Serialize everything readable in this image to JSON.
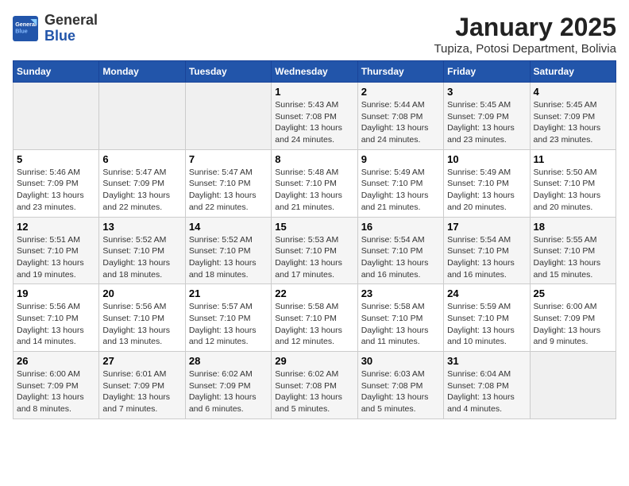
{
  "header": {
    "logo_general": "General",
    "logo_blue": "Blue",
    "month_title": "January 2025",
    "location": "Tupiza, Potosi Department, Bolivia"
  },
  "weekdays": [
    "Sunday",
    "Monday",
    "Tuesday",
    "Wednesday",
    "Thursday",
    "Friday",
    "Saturday"
  ],
  "weeks": [
    [
      {
        "day": "",
        "info": ""
      },
      {
        "day": "",
        "info": ""
      },
      {
        "day": "",
        "info": ""
      },
      {
        "day": "1",
        "info": "Sunrise: 5:43 AM\nSunset: 7:08 PM\nDaylight: 13 hours\nand 24 minutes."
      },
      {
        "day": "2",
        "info": "Sunrise: 5:44 AM\nSunset: 7:08 PM\nDaylight: 13 hours\nand 24 minutes."
      },
      {
        "day": "3",
        "info": "Sunrise: 5:45 AM\nSunset: 7:09 PM\nDaylight: 13 hours\nand 23 minutes."
      },
      {
        "day": "4",
        "info": "Sunrise: 5:45 AM\nSunset: 7:09 PM\nDaylight: 13 hours\nand 23 minutes."
      }
    ],
    [
      {
        "day": "5",
        "info": "Sunrise: 5:46 AM\nSunset: 7:09 PM\nDaylight: 13 hours\nand 23 minutes."
      },
      {
        "day": "6",
        "info": "Sunrise: 5:47 AM\nSunset: 7:09 PM\nDaylight: 13 hours\nand 22 minutes."
      },
      {
        "day": "7",
        "info": "Sunrise: 5:47 AM\nSunset: 7:10 PM\nDaylight: 13 hours\nand 22 minutes."
      },
      {
        "day": "8",
        "info": "Sunrise: 5:48 AM\nSunset: 7:10 PM\nDaylight: 13 hours\nand 21 minutes."
      },
      {
        "day": "9",
        "info": "Sunrise: 5:49 AM\nSunset: 7:10 PM\nDaylight: 13 hours\nand 21 minutes."
      },
      {
        "day": "10",
        "info": "Sunrise: 5:49 AM\nSunset: 7:10 PM\nDaylight: 13 hours\nand 20 minutes."
      },
      {
        "day": "11",
        "info": "Sunrise: 5:50 AM\nSunset: 7:10 PM\nDaylight: 13 hours\nand 20 minutes."
      }
    ],
    [
      {
        "day": "12",
        "info": "Sunrise: 5:51 AM\nSunset: 7:10 PM\nDaylight: 13 hours\nand 19 minutes."
      },
      {
        "day": "13",
        "info": "Sunrise: 5:52 AM\nSunset: 7:10 PM\nDaylight: 13 hours\nand 18 minutes."
      },
      {
        "day": "14",
        "info": "Sunrise: 5:52 AM\nSunset: 7:10 PM\nDaylight: 13 hours\nand 18 minutes."
      },
      {
        "day": "15",
        "info": "Sunrise: 5:53 AM\nSunset: 7:10 PM\nDaylight: 13 hours\nand 17 minutes."
      },
      {
        "day": "16",
        "info": "Sunrise: 5:54 AM\nSunset: 7:10 PM\nDaylight: 13 hours\nand 16 minutes."
      },
      {
        "day": "17",
        "info": "Sunrise: 5:54 AM\nSunset: 7:10 PM\nDaylight: 13 hours\nand 16 minutes."
      },
      {
        "day": "18",
        "info": "Sunrise: 5:55 AM\nSunset: 7:10 PM\nDaylight: 13 hours\nand 15 minutes."
      }
    ],
    [
      {
        "day": "19",
        "info": "Sunrise: 5:56 AM\nSunset: 7:10 PM\nDaylight: 13 hours\nand 14 minutes."
      },
      {
        "day": "20",
        "info": "Sunrise: 5:56 AM\nSunset: 7:10 PM\nDaylight: 13 hours\nand 13 minutes."
      },
      {
        "day": "21",
        "info": "Sunrise: 5:57 AM\nSunset: 7:10 PM\nDaylight: 13 hours\nand 12 minutes."
      },
      {
        "day": "22",
        "info": "Sunrise: 5:58 AM\nSunset: 7:10 PM\nDaylight: 13 hours\nand 12 minutes."
      },
      {
        "day": "23",
        "info": "Sunrise: 5:58 AM\nSunset: 7:10 PM\nDaylight: 13 hours\nand 11 minutes."
      },
      {
        "day": "24",
        "info": "Sunrise: 5:59 AM\nSunset: 7:10 PM\nDaylight: 13 hours\nand 10 minutes."
      },
      {
        "day": "25",
        "info": "Sunrise: 6:00 AM\nSunset: 7:09 PM\nDaylight: 13 hours\nand 9 minutes."
      }
    ],
    [
      {
        "day": "26",
        "info": "Sunrise: 6:00 AM\nSunset: 7:09 PM\nDaylight: 13 hours\nand 8 minutes."
      },
      {
        "day": "27",
        "info": "Sunrise: 6:01 AM\nSunset: 7:09 PM\nDaylight: 13 hours\nand 7 minutes."
      },
      {
        "day": "28",
        "info": "Sunrise: 6:02 AM\nSunset: 7:09 PM\nDaylight: 13 hours\nand 6 minutes."
      },
      {
        "day": "29",
        "info": "Sunrise: 6:02 AM\nSunset: 7:08 PM\nDaylight: 13 hours\nand 5 minutes."
      },
      {
        "day": "30",
        "info": "Sunrise: 6:03 AM\nSunset: 7:08 PM\nDaylight: 13 hours\nand 5 minutes."
      },
      {
        "day": "31",
        "info": "Sunrise: 6:04 AM\nSunset: 7:08 PM\nDaylight: 13 hours\nand 4 minutes."
      },
      {
        "day": "",
        "info": ""
      }
    ]
  ]
}
